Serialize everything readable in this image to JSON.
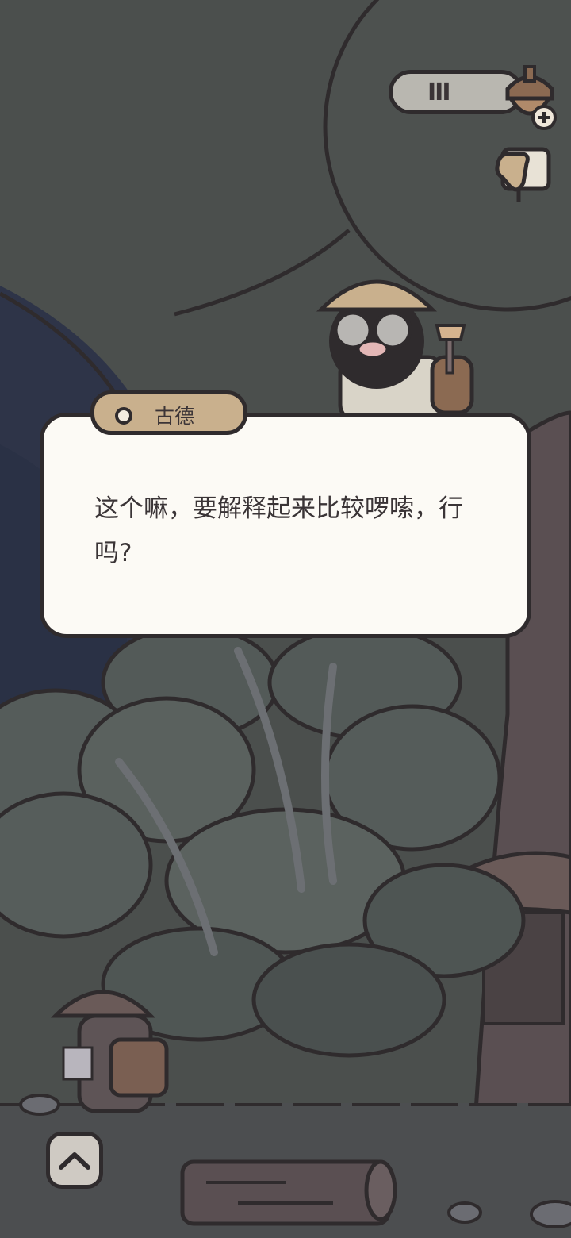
{
  "hud": {
    "currency_count": "III",
    "currency_icon": "acorn-plus-icon",
    "action_icon": "pointing-hand-icon"
  },
  "dialog": {
    "speaker": "古德",
    "text": "这个嘛，要解释起来比较啰嗦，行吗?"
  },
  "controls": {
    "expand_icon": "chevron-up-icon"
  },
  "colors": {
    "sky_dark": "#4b4f4d",
    "night_blue": "#2e3448",
    "dialog_bg": "#fcfaf5",
    "tab_bg": "#c9b08d",
    "outline": "#2f2b2d"
  }
}
